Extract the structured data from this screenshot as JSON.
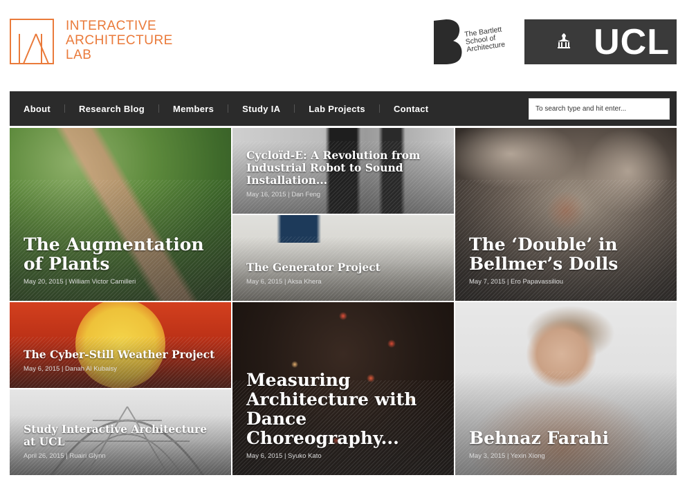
{
  "logo": {
    "lines": [
      "INTERACTIVE",
      "ARCHITECTURE",
      "LAB"
    ],
    "color": "#ea7a3a"
  },
  "bartlett": {
    "lines": [
      "The Bartlett",
      "School of",
      "Architecture"
    ]
  },
  "ucl": {
    "text": "UCL"
  },
  "nav": {
    "items": [
      "About",
      "Research Blog",
      "Members",
      "Study IA",
      "Lab Projects",
      "Contact"
    ],
    "search_placeholder": "To search type and hit enter..."
  },
  "posts": [
    {
      "title": "The Augmentation of Plants",
      "date": "May 20, 2015",
      "author": "William Victor Camilleri"
    },
    {
      "title": "Cycloïd-E: A Revolution from Industrial Robot to Sound Installation...",
      "date": "May 16, 2015",
      "author": "Dan Feng"
    },
    {
      "title": "The Generator Project",
      "date": "May 6, 2015",
      "author": "Aksa Khera"
    },
    {
      "title": "The ‘Double’ in Bellmer’s Dolls",
      "date": "May 7, 2015",
      "author": "Ero Papavassiliou"
    },
    {
      "title": "The Cyber-Still Weather Project",
      "date": "May 6, 2015",
      "author": "Danah Al Kubaisy"
    },
    {
      "title": "Study Interactive Architecture at UCL",
      "date": "April 26, 2015",
      "author": "Ruairi Glynn"
    },
    {
      "title": "Measuring Architecture with Dance Choreography...",
      "date": "May 6, 2015",
      "author": "Syuko Kato"
    },
    {
      "title": "Behnaz Farahi",
      "date": "May 3, 2015",
      "author": "Yexin Xiong"
    }
  ],
  "separator": "|"
}
